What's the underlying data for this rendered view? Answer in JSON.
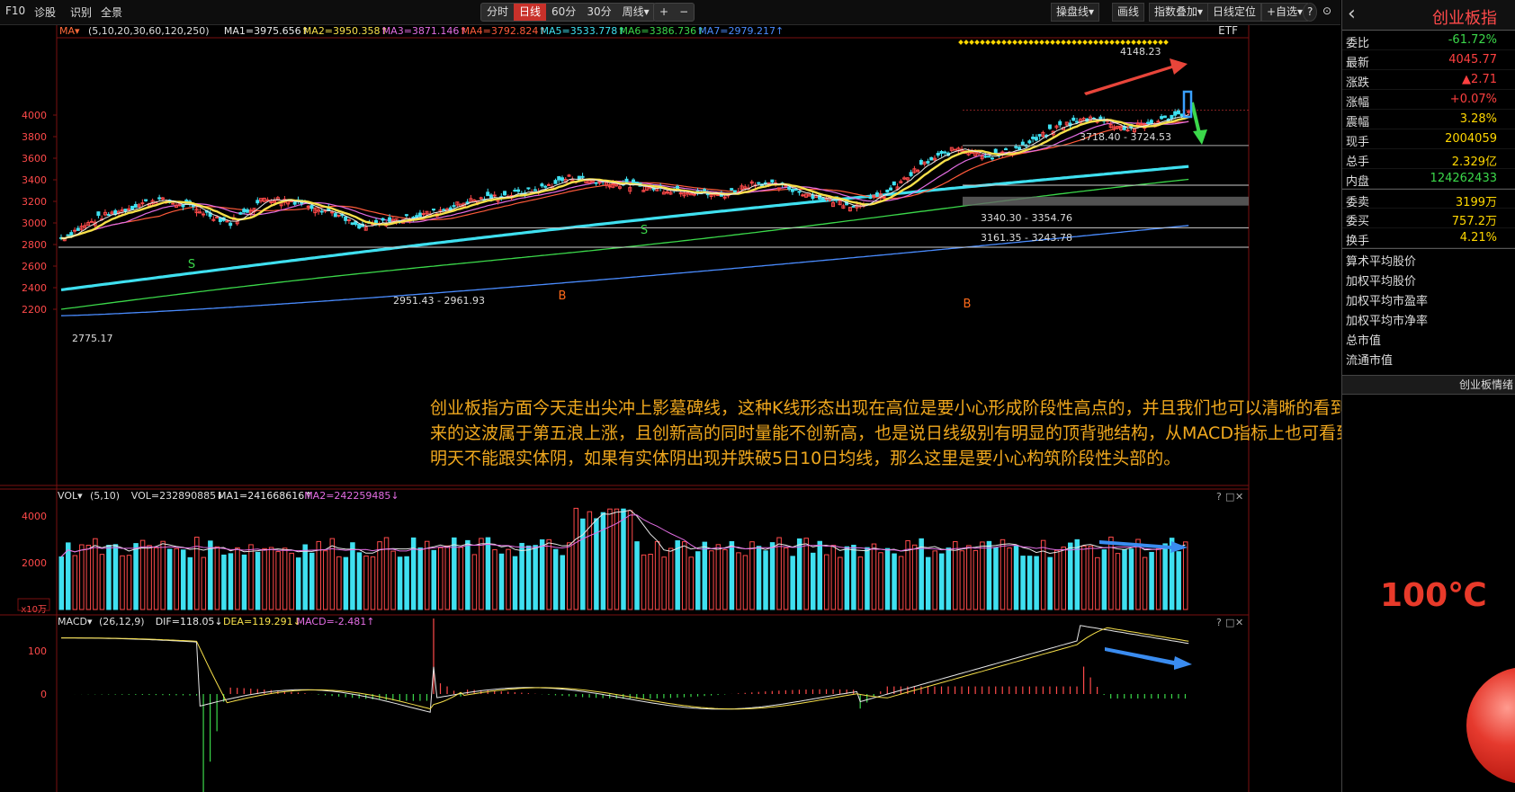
{
  "toolbar": {
    "nav": [
      "F10",
      "诊股",
      "识别",
      "全景"
    ],
    "periods": [
      "分时",
      "日线",
      "60分",
      "30分",
      "周线▾"
    ],
    "active_period": "日线",
    "zoom_in": "+",
    "zoom_out": "−",
    "right_tools": [
      "操盘线▾",
      "画线",
      "指数叠加▾",
      "日线定位",
      "+自选▾"
    ],
    "help": "?",
    "settings": "⊙"
  },
  "main_chart": {
    "ma_label": "MA▾",
    "ma_legend": [
      {
        "text": "(5,10,20,30,60,120,250)",
        "color": "#dddddd"
      },
      {
        "text": "MA1=3975.656↑",
        "color": "#e8e8e8"
      },
      {
        "text": "MA2=3950.358↑",
        "color": "#f7e04a"
      },
      {
        "text": "MA3=3871.146↑",
        "color": "#e36de3"
      },
      {
        "text": "MA4=3792.824↑",
        "color": "#ff5a3a"
      },
      {
        "text": "MA5=3533.778↑",
        "color": "#3fe0f0"
      },
      {
        "text": "MA6=3386.736↑",
        "color": "#3bd84a"
      },
      {
        "text": "MA7=2979.217↑",
        "color": "#4a8cff"
      }
    ],
    "etf": "ETF",
    "y_ticks": [
      4000,
      3800,
      3600,
      3400,
      3200,
      3000,
      2800,
      2600,
      2400,
      2200
    ],
    "annotations": [
      "4148.23",
      "3718.40 - 3724.53",
      "3340.30 - 3354.76",
      "3161.35 - 3243.78",
      "2951.43 - 2961.93",
      "2775.17"
    ],
    "markers": [
      "S",
      "S",
      "B",
      "B"
    ]
  },
  "vol_panel": {
    "label": "VOL▾",
    "legend": [
      {
        "text": "(5,10)",
        "color": "#dddddd"
      },
      {
        "text": "VOL=232890885↓",
        "color": "#dddddd"
      },
      {
        "text": "MA1=241668616↑",
        "color": "#e8e8e8"
      },
      {
        "text": "MA2=242259485↓",
        "color": "#e36de3"
      }
    ],
    "y_ticks": [
      "4000",
      "2000"
    ],
    "unit": "x10万"
  },
  "macd_panel": {
    "label": "MACD▾",
    "legend": [
      {
        "text": "(26,12,9)",
        "color": "#dddddd"
      },
      {
        "text": "DIF=118.05↓",
        "color": "#e8e8e8"
      },
      {
        "text": "DEA=119.291↓",
        "color": "#f7e04a"
      },
      {
        "text": "MACD=-2.481↑",
        "color": "#e36de3"
      }
    ],
    "y_ticks": [
      "100",
      "0"
    ]
  },
  "commentary": "创业板指方面今天走出尖冲上影墓碑线，这种K线形态出现在高位是要小心形成阶段性高点的，并且我们也可以清晰的看到，创业板指5月22日以来的这波属于第五浪上涨，且创新高的同时量能不创新高，也是说日线级别有明显的顶背驰结构，从MACD指标上也可看到顶背离的迹象。所以明天不能跟实体阴，如果有实体阴出现并跌破5日10日均线，那么这里是要小心构筑阶段性头部的。",
  "right_panel": {
    "back": "‹",
    "title": "创业板指",
    "rows": [
      {
        "label": "委比",
        "value": "-61.72%",
        "color": "#3bd84a"
      },
      {
        "label": "最新",
        "value": "4045.77",
        "color": "#ff4040"
      },
      {
        "label": "涨跌",
        "value": "▲2.71",
        "color": "#ff4040"
      },
      {
        "label": "涨幅",
        "value": "+0.07%",
        "color": "#ff4040"
      },
      {
        "label": "震幅",
        "value": "3.28%",
        "color": "#ffd700"
      },
      {
        "label": "现手",
        "value": "2004059",
        "color": "#ffd700"
      },
      {
        "label": "总手",
        "value": "2.329亿",
        "color": "#ffd700"
      },
      {
        "label": "内盘",
        "value": "124262433",
        "color": "#3bd84a"
      },
      {
        "label": "委卖",
        "value": "3199万",
        "color": "#ffd700"
      },
      {
        "label": "委买",
        "value": "757.2万",
        "color": "#ffd700"
      },
      {
        "label": "换手",
        "value": "4.21%",
        "color": "#ffd700"
      }
    ],
    "plain": [
      "算术平均股价",
      "加权平均股价",
      "加权平均市盈率",
      "加权平均市净率",
      "总市值",
      "流通市值"
    ],
    "sentiment_title": "创业板情绪",
    "temperature": "100℃"
  },
  "colors": {
    "up": "#ff4a4a",
    "down": "#3fe0f0",
    "ma1": "#e8e8e8",
    "ma2": "#f7e04a",
    "ma3": "#e36de3",
    "ma4": "#ff5a3a",
    "ma5": "#3fe0f0",
    "ma6": "#3bd84a",
    "ma7": "#4a8cff",
    "commentary": "#f0a81e"
  }
}
